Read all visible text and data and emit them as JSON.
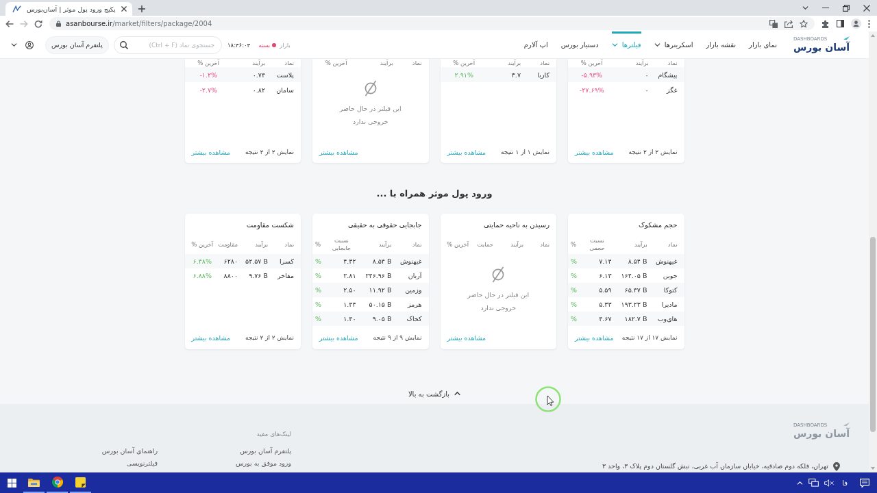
{
  "browser": {
    "tab_title": "پکیج ورود پول موثر | آسان‌بورس",
    "url_host": "asanbourse.ir",
    "url_path": "/market/filters/package/2004"
  },
  "header": {
    "logo": {
      "name": "آسان بورس",
      "tagline": "DASHBOARDS"
    },
    "nav": [
      {
        "label": "نمای بازار",
        "selected": false,
        "has_menu": false
      },
      {
        "label": "نقشه بازار",
        "selected": false,
        "has_menu": false
      },
      {
        "label": "اسکرینرها",
        "selected": false,
        "has_menu": true
      },
      {
        "label": "فیلترها",
        "selected": true,
        "has_menu": true
      },
      {
        "label": "دستیار بورس",
        "selected": false,
        "has_menu": false
      },
      {
        "label": "اپ آلارم",
        "selected": false,
        "has_menu": false
      }
    ],
    "market": {
      "label": "بازار",
      "status": "بسته",
      "open": false,
      "time": "۱۸:۳۶:۰۳"
    },
    "search": {
      "placeholder": "جستجوی نماد (Ctrl + F)"
    },
    "platform_button": "پلتفرم آسان بورس"
  },
  "top_cards": [
    {
      "kind": "table",
      "columns": [
        "نماد",
        "برآیند",
        "آخرین %"
      ],
      "rows": [
        {
          "cells": [
            "پیشگام",
            "۰",
            "-۵.۹۳%"
          ],
          "gain": false
        },
        {
          "cells": [
            "غگز",
            "۰",
            "-۲۷.۶۹%"
          ],
          "gain": false
        }
      ],
      "result_count": "نمایش ۲ از ۲ نتیجه",
      "more_link": "مشاهده بیشتر"
    },
    {
      "kind": "table",
      "columns": [
        "نماد",
        "برآیند",
        "آخرین %"
      ],
      "rows": [
        {
          "cells": [
            "کاربا",
            "۳.۷",
            "۲.۹۱%"
          ],
          "gain": true
        }
      ],
      "result_count": "نمایش ۱ از ۱ نتیجه",
      "more_link": "مشاهده بیشتر"
    },
    {
      "kind": "empty",
      "columns": [
        "نماد",
        "برآیند",
        "آخرین %"
      ],
      "empty_message": "این فیلتر در حال حاضر خروجی ندارد",
      "more_link": "مشاهده بیشتر"
    },
    {
      "kind": "table",
      "columns": [
        "نماد",
        "برآیند",
        "آخرین %"
      ],
      "rows": [
        {
          "cells": [
            "پلاست",
            "۰.۷۴",
            "-۱.۲%"
          ],
          "gain": false
        },
        {
          "cells": [
            "سامان",
            "۰.۸۲",
            "-۲.۷%"
          ],
          "gain": false
        }
      ],
      "result_count": "نمایش ۲ از ۲ نتیجه",
      "more_link": "مشاهده بیشتر"
    }
  ],
  "section_title": "ورود پول موثر همراه با ...",
  "cards": [
    {
      "title": "حجم مشکوک",
      "kind": "scroll_table",
      "columns": [
        "نماد",
        "برآیند",
        "نسبت حجمی",
        "%"
      ],
      "rows": [
        {
          "cells": [
            "غیهنوش",
            "۸.۵۴ B",
            "۷.۱۴",
            "%"
          ],
          "gain": true
        },
        {
          "cells": [
            "جوین",
            "۱۶۴.۰۵ B",
            "۶.۱۳",
            "%"
          ],
          "gain": true
        },
        {
          "cells": [
            "کتوکا",
            "۶۵.۴۷ B",
            "۵.۵۹",
            "%"
          ],
          "gain": true
        },
        {
          "cells": [
            "مادیرا",
            "۱۹۳.۲۳ B",
            "۵.۳۳",
            "%"
          ],
          "gain": true
        },
        {
          "cells": [
            "های‌وب",
            "۱۸۲.۷ B",
            "۴.۶۷",
            "%"
          ],
          "gain": true
        }
      ],
      "result_count": "نمایش ۱۷ از ۱۷ نتیجه",
      "more_link": "مشاهده بیشتر"
    },
    {
      "title": "رسیدن به ناحیه حمایتی",
      "kind": "empty",
      "columns": [
        "نماد",
        "برآیند",
        "حمایت",
        "آخرین %"
      ],
      "empty_message": "این فیلتر در حال حاضر خروجی ندارد",
      "more_link": "مشاهده بیشتر"
    },
    {
      "title": "جابجایی حقوقی به حقیقی",
      "kind": "scroll_table",
      "columns": [
        "نماد",
        "برآیند",
        "نسبت جابجایی",
        "%"
      ],
      "rows": [
        {
          "cells": [
            "غیهنوش",
            "۸.۵۴ B",
            "۴.۳۲",
            "%"
          ],
          "gain": true
        },
        {
          "cells": [
            "آریان",
            "۲۴۶.۹۶ B",
            "۲.۸۱",
            "%"
          ],
          "gain": true
        },
        {
          "cells": [
            "وزمین",
            "۱۱.۹۲ B",
            "۲.۵۰",
            "%"
          ],
          "gain": true
        },
        {
          "cells": [
            "هرمز",
            "۵۰.۱۵ B",
            "۱.۴۴",
            "%"
          ],
          "gain": true
        },
        {
          "cells": [
            "کخاک",
            "۹.۰۵ B",
            "۱.۴۰",
            "%"
          ],
          "gain": true
        }
      ],
      "result_count": "نمایش ۹ از ۹ نتیجه",
      "more_link": "مشاهده بیشتر"
    },
    {
      "title": "شکست مقاومت",
      "kind": "table",
      "columns": [
        "نماد",
        "برآیند",
        "مقاومت",
        "آخرین %"
      ],
      "rows": [
        {
          "cells": [
            "کسرا",
            "۵۲.۵۷ B",
            "۶۲۸۰",
            "۶.۴۸%"
          ],
          "gain": true
        },
        {
          "cells": [
            "مفاخر",
            "۹.۷۶ B",
            "۸۸۰۰",
            "۶.۸۸%"
          ],
          "gain": true
        }
      ],
      "result_count": "نمایش ۲ از ۲ نتیجه",
      "more_link": "مشاهده بیشتر"
    }
  ],
  "back_to_top": "بازگشت به بالا",
  "footer": {
    "logo": {
      "name": "آسان بورس",
      "tagline": "DASHBOARDS"
    },
    "links_title": "لینک‌های مفید",
    "link_columns": [
      {
        "links": [
          "پلتفرم آسان بورس",
          "ورود موفق به بورس"
        ]
      },
      {
        "links": [
          "راهنمای آسان بورس",
          "فیلترنویسی"
        ]
      }
    ],
    "address": "تهران، فلکه دوم صادقیه، خیابان سازمان آب غربی، نبش گلستان دوم پلاک ۳، واحد ۳"
  },
  "taskbar": {
    "language": "فا"
  }
}
